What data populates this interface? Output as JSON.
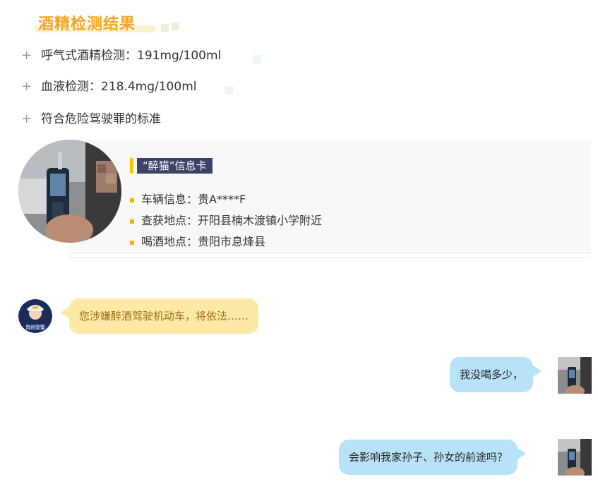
{
  "header": {
    "title": "酒精检测结果"
  },
  "results": [
    {
      "label": "呼气式酒精检测：191mg/100ml"
    },
    {
      "label": "血液检测：218.4mg/100ml"
    },
    {
      "label": "符合危险驾驶罪的标准"
    }
  ],
  "card": {
    "tag": "“醉猫”信息卡",
    "items": [
      {
        "text": "车辆信息：贵A****F"
      },
      {
        "text": "查获地点：开阳县楠木渡镇小学附近"
      },
      {
        "text": "喝酒地点：贵阳市息烽县"
      }
    ]
  },
  "chat": {
    "police_avatar_text": "贵州交警",
    "police_message": "您涉嫌醉酒驾驶机动车，将依法……",
    "driver_message_1": "我没喝多少，",
    "driver_message_2": "会影响我家孙子、孙女的前途吗？"
  },
  "colors": {
    "title": "#f5a623",
    "tag_bg": "#3b4366",
    "tag_bar": "#f7c600",
    "police_bubble": "#fde9a6",
    "driver_bubble": "#b8e2f8"
  }
}
